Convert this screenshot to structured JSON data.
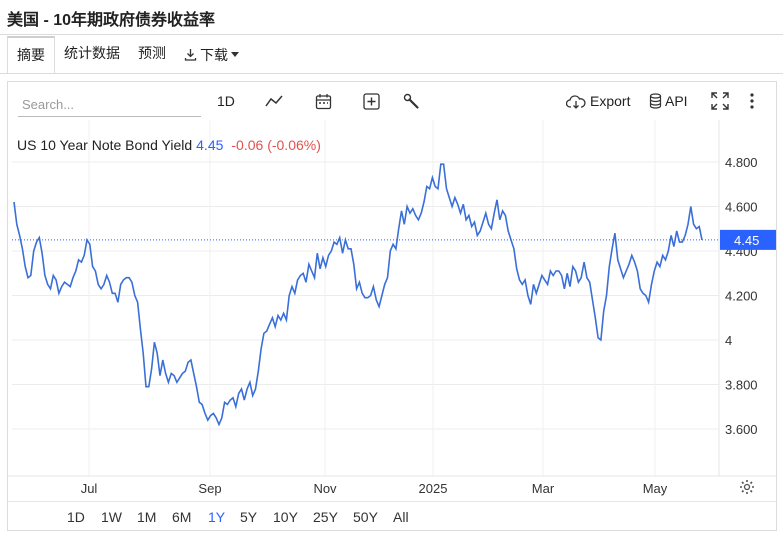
{
  "page": {
    "title": "美国 - 10年期政府债券收益率"
  },
  "tabs": [
    {
      "label": "摘要",
      "active": true
    },
    {
      "label": "统计数据",
      "active": false
    },
    {
      "label": "预测",
      "active": false
    },
    {
      "label": "下载",
      "active": false
    }
  ],
  "toolbar": {
    "search_placeholder": "Search...",
    "interval": "1D",
    "export_label": "Export",
    "api_label": "API",
    "icons": [
      "line-chart-icon",
      "calendar-icon",
      "plus-box-icon",
      "wrench-icon",
      "cloud-download-icon",
      "database-icon",
      "fullscreen-icon",
      "more-vertical-icon",
      "settings-gear-icon"
    ]
  },
  "legend": {
    "name": "US 10 Year Note Bond Yield",
    "value": "4.45",
    "change": "-0.06 (-0.06%)"
  },
  "colors": {
    "line": "#3a6fd8",
    "accent": "#2962ff",
    "negative": "#e0534f",
    "last_label_bg": "#2962ff"
  },
  "range_buttons": [
    "1D",
    "1W",
    "1M",
    "6M",
    "1Y",
    "5Y",
    "10Y",
    "25Y",
    "50Y",
    "All"
  ],
  "active_range": "1Y",
  "chart_data": {
    "type": "line",
    "series": [
      {
        "name": "US 10 Year Note Bond Yield"
      }
    ],
    "x_ticks": [
      "Jul",
      "Sep",
      "Nov",
      "2025",
      "Mar",
      "May"
    ],
    "y_ticks": [
      "4.800",
      "4.600",
      "4.400",
      "4.200",
      "4",
      "3.800",
      "3.600"
    ],
    "y_tick_values": [
      4.8,
      4.6,
      4.4,
      4.2,
      4.0,
      3.8,
      3.6
    ],
    "ylim": [
      3.42,
      4.99
    ],
    "last_value": 4.45,
    "last_value_label": "4.45",
    "grid": true,
    "x_index_range": [
      0,
      250
    ],
    "tick_index": [
      37,
      94,
      152,
      209,
      264,
      320
    ],
    "values": [
      4.62,
      4.52,
      4.47,
      4.41,
      4.33,
      4.28,
      4.29,
      4.4,
      4.44,
      4.46,
      4.39,
      4.29,
      4.25,
      4.23,
      4.29,
      4.27,
      4.21,
      4.24,
      4.26,
      4.25,
      4.24,
      4.28,
      4.31,
      4.36,
      4.35,
      4.38,
      4.45,
      4.43,
      4.33,
      4.31,
      4.25,
      4.23,
      4.25,
      4.29,
      4.26,
      4.21,
      4.21,
      4.17,
      4.25,
      4.27,
      4.28,
      4.28,
      4.26,
      4.2,
      4.17,
      4.05,
      3.94,
      3.79,
      3.79,
      3.87,
      3.99,
      3.94,
      3.84,
      3.91,
      3.85,
      3.81,
      3.85,
      3.84,
      3.81,
      3.83,
      3.85,
      3.86,
      3.9,
      3.91,
      3.85,
      3.79,
      3.72,
      3.71,
      3.67,
      3.64,
      3.66,
      3.67,
      3.65,
      3.62,
      3.65,
      3.72,
      3.71,
      3.73,
      3.74,
      3.7,
      3.76,
      3.78,
      3.73,
      3.78,
      3.81,
      3.75,
      3.78,
      3.86,
      3.96,
      4.03,
      4.04,
      4.07,
      4.1,
      4.06,
      4.11,
      4.09,
      4.12,
      4.09,
      4.2,
      4.24,
      4.21,
      4.27,
      4.29,
      4.3,
      4.26,
      4.34,
      4.31,
      4.28,
      4.39,
      4.32,
      4.37,
      4.33,
      4.38,
      4.4,
      4.44,
      4.43,
      4.46,
      4.39,
      4.45,
      4.41,
      4.41,
      4.34,
      4.23,
      4.26,
      4.21,
      4.19,
      4.19,
      4.2,
      4.24,
      4.18,
      4.15,
      4.2,
      4.25,
      4.28,
      4.4,
      4.43,
      4.41,
      4.5,
      4.58,
      4.52,
      4.6,
      4.57,
      4.59,
      4.56,
      4.54,
      4.57,
      4.62,
      4.69,
      4.68,
      4.73,
      4.69,
      4.68,
      4.79,
      4.79,
      4.68,
      4.64,
      4.6,
      4.64,
      4.61,
      4.57,
      4.61,
      4.54,
      4.56,
      4.51,
      4.53,
      4.47,
      4.49,
      4.53,
      4.57,
      4.52,
      4.5,
      4.57,
      4.63,
      4.54,
      4.58,
      4.56,
      4.49,
      4.45,
      4.41,
      4.32,
      4.27,
      4.25,
      4.27,
      4.2,
      4.16,
      4.25,
      4.21,
      4.25,
      4.29,
      4.27,
      4.25,
      4.31,
      4.29,
      4.31,
      4.31,
      4.29,
      4.23,
      4.3,
      4.24,
      4.33,
      4.31,
      4.26,
      4.28,
      4.35,
      4.28,
      4.26,
      4.18,
      4.1,
      4.01,
      4.0,
      4.13,
      4.2,
      4.33,
      4.41,
      4.48,
      4.36,
      4.32,
      4.28,
      4.31,
      4.34,
      4.38,
      4.35,
      4.31,
      4.23,
      4.21,
      4.2,
      4.17,
      4.25,
      4.31,
      4.35,
      4.33,
      4.38,
      4.36,
      4.4,
      4.47,
      4.42,
      4.49,
      4.44,
      4.44,
      4.47,
      4.52,
      4.6,
      4.52,
      4.5,
      4.51,
      4.45
    ]
  }
}
